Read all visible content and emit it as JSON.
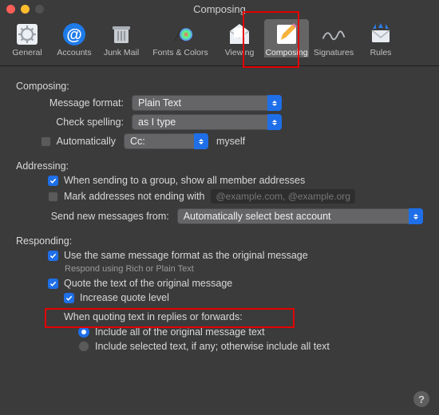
{
  "window": {
    "title": "Composing"
  },
  "toolbar": {
    "items": [
      {
        "label": "General"
      },
      {
        "label": "Accounts"
      },
      {
        "label": "Junk Mail"
      },
      {
        "label": "Fonts & Colors"
      },
      {
        "label": "Viewing"
      },
      {
        "label": "Composing"
      },
      {
        "label": "Signatures"
      },
      {
        "label": "Rules"
      }
    ]
  },
  "composing": {
    "heading": "Composing:",
    "message_format_label": "Message format:",
    "message_format_value": "Plain Text",
    "check_spelling_label": "Check spelling:",
    "check_spelling_value": "as I type",
    "auto_label": "Automatically",
    "auto_field_value": "Cc:",
    "auto_suffix": "myself"
  },
  "addressing": {
    "heading": "Addressing:",
    "group_label": "When sending to a group, show all member addresses",
    "mark_label": "Mark addresses not ending with",
    "mark_placeholder": "@example.com, @example.org",
    "send_from_label": "Send new messages from:",
    "send_from_value": "Automatically select best account"
  },
  "responding": {
    "heading": "Responding:",
    "same_format_label": "Use the same message format as the original message",
    "same_format_sub": "Respond using Rich or Plain Text",
    "quote_label": "Quote the text of the original message",
    "increase_label": "Increase quote level",
    "when_quoting_label": "When quoting text in replies or forwards:",
    "include_all_label": "Include all of the original message text",
    "include_sel_label": "Include selected text, if any; otherwise include all text"
  }
}
